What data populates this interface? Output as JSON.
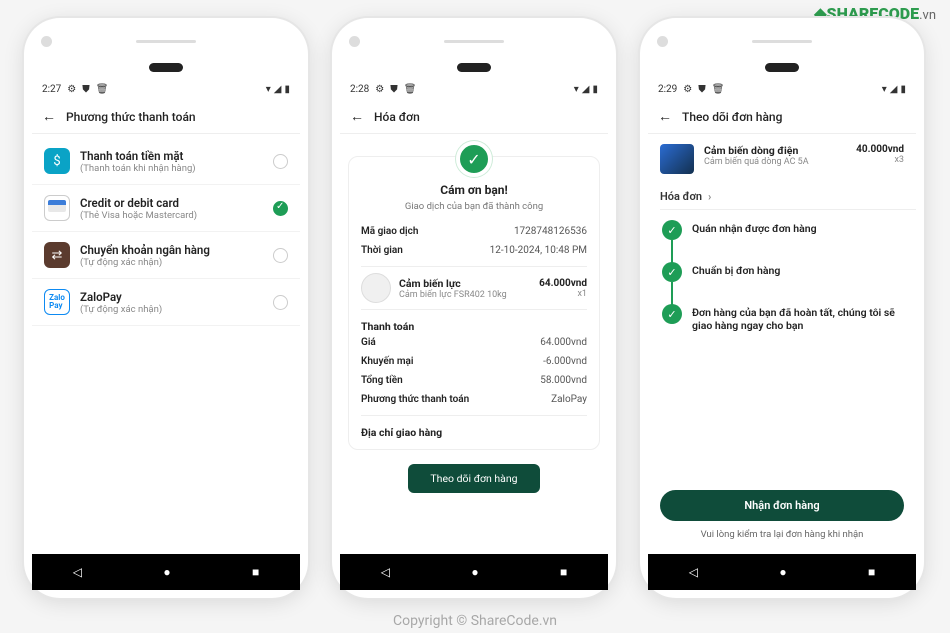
{
  "brand": {
    "name": "SHARECODE",
    "suffix": ".vn"
  },
  "watermark": {
    "center": "ShareCode.vn",
    "bottom": "Copyright © ShareCode.vn"
  },
  "screen1": {
    "time": "2:27",
    "appbar": "Phương thức thanh toán",
    "methods": [
      {
        "title": "Thanh toán tiền mặt",
        "sub": "(Thanh toán khi nhận hàng)",
        "selected": false
      },
      {
        "title": "Credit or debit card",
        "sub": "(Thẻ Visa hoặc Mastercard)",
        "selected": true
      },
      {
        "title": "Chuyển khoản ngân hàng",
        "sub": "(Tự động xác nhận)",
        "selected": false
      },
      {
        "title": "ZaloPay",
        "sub": "(Tự động xác nhận)",
        "selected": false
      }
    ]
  },
  "screen2": {
    "time": "2:28",
    "appbar": "Hóa đơn",
    "thank": "Cám ơn bạn!",
    "thank_sub": "Giao dịch của bạn đã thành công",
    "txid_label": "Mã giao dịch",
    "txid": "1728748126536",
    "time_label": "Thời gian",
    "time_value": "12-10-2024, 10:48 PM",
    "product": {
      "title": "Cảm biến lực",
      "sub": "Cảm biến lực FSR402 10kg",
      "price": "64.000vnd",
      "qty": "x1"
    },
    "pay_section": "Thanh toán",
    "rows": [
      {
        "k": "Giá",
        "v": "64.000vnd"
      },
      {
        "k": "Khuyến mại",
        "v": "-6.000vnd"
      },
      {
        "k": "Tổng tiền",
        "v": "58.000vnd"
      },
      {
        "k": "Phương thức thanh toán",
        "v": "ZaloPay"
      }
    ],
    "addr_section": "Địa chỉ giao hàng",
    "track_btn": "Theo dõi đơn hàng"
  },
  "screen3": {
    "time": "2:29",
    "appbar": "Theo dõi đơn hàng",
    "product": {
      "title": "Cảm biến dòng điện",
      "sub": "Cảm biến quá dòng AC 5A",
      "price": "40.000vnd",
      "qty": "x3"
    },
    "invoice_link": "Hóa đơn",
    "steps": [
      "Quán nhận được đơn hàng",
      "Chuẩn bị đơn hàng",
      "Đơn hàng của bạn đã hoàn tất, chúng tôi sẽ giao hàng ngay cho bạn"
    ],
    "receive_btn": "Nhận đơn hàng",
    "note": "Vui lòng kiểm tra lại đơn hàng khi nhận"
  }
}
